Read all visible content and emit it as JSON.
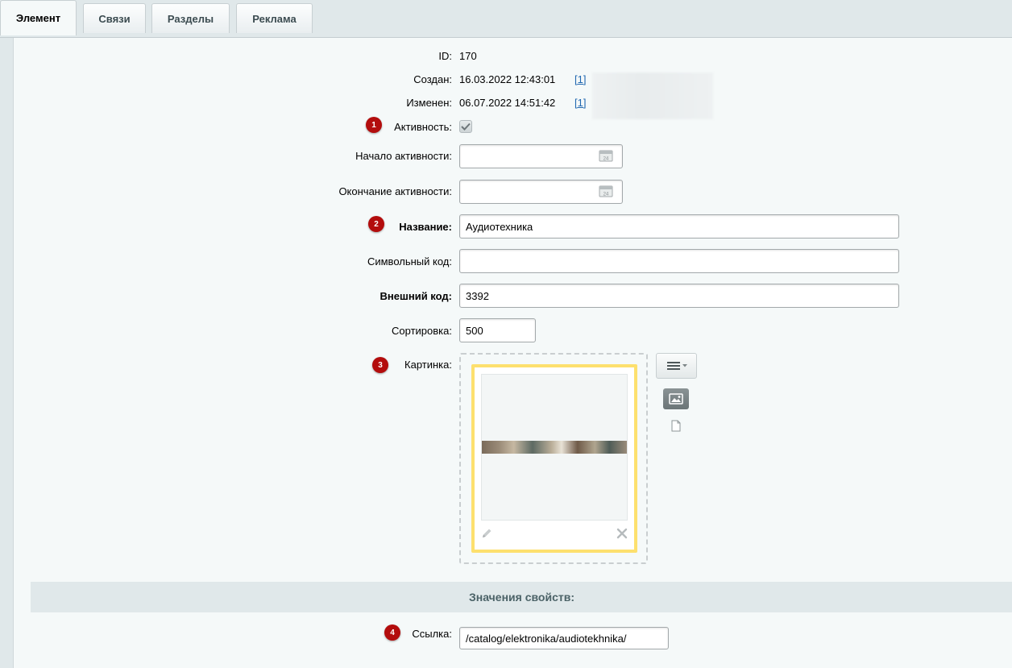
{
  "tabs": [
    {
      "label": "Элемент",
      "active": true
    },
    {
      "label": "Связи",
      "active": false
    },
    {
      "label": "Разделы",
      "active": false
    },
    {
      "label": "Реклама",
      "active": false
    }
  ],
  "form": {
    "id": {
      "label": "ID:",
      "value": "170"
    },
    "created": {
      "label": "Создан:",
      "value": "16.03.2022 12:43:01",
      "user_link": "[1]"
    },
    "modified": {
      "label": "Изменен:",
      "value": "06.07.2022 14:51:42",
      "user_link": "[1]"
    },
    "active": {
      "label": "Активность:",
      "checked": true,
      "badge": "1"
    },
    "active_from": {
      "label": "Начало активности:",
      "value": ""
    },
    "active_to": {
      "label": "Окончание активности:",
      "value": ""
    },
    "name": {
      "label": "Название:",
      "value": "Аудиотехника",
      "badge": "2"
    },
    "code": {
      "label": "Символьный код:",
      "value": ""
    },
    "xml_id": {
      "label": "Внешний код:",
      "value": "3392"
    },
    "sort": {
      "label": "Сортировка:",
      "value": "500"
    },
    "picture": {
      "label": "Картинка:",
      "badge": "3"
    }
  },
  "properties": {
    "header": "Значения свойств:",
    "link": {
      "label": "Ссылка:",
      "value": "/catalog/elektronika/audiotekhnika/",
      "badge": "4"
    }
  },
  "icons": {
    "calendar": "calendar-icon",
    "menu": "menu-icon",
    "image": "image-icon",
    "file": "file-icon",
    "edit": "pencil-icon",
    "delete": "close-icon"
  },
  "colors": {
    "badge": "#b30d0d",
    "card_border": "#fde06e",
    "link": "#2067b0"
  }
}
